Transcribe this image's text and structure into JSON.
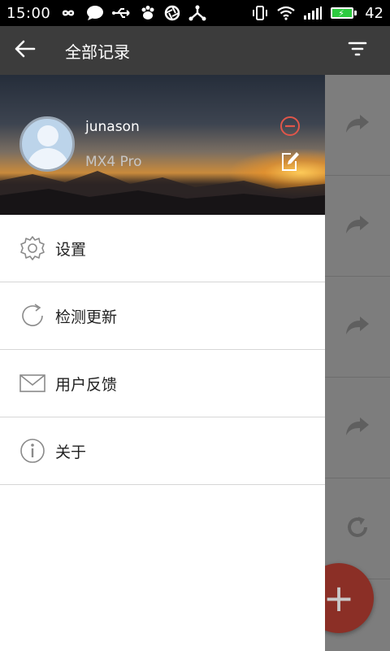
{
  "status_bar": {
    "time": "15:00",
    "battery_level": "42",
    "icons": [
      "infinity-icon",
      "chat-bubble-icon",
      "usb-icon",
      "paw-icon",
      "aperture-icon",
      "share-icon",
      "vibrate-icon",
      "wifi-icon",
      "signal-icon",
      "battery-charging-icon"
    ]
  },
  "app_bar": {
    "title": "全部记录",
    "back_icon": "back-arrow-icon",
    "filter_icon": "filter-icon"
  },
  "drawer": {
    "user": {
      "name": "junason",
      "device": "MX4 Pro"
    },
    "menu": [
      {
        "label": "设置",
        "icon": "gear-icon"
      },
      {
        "label": "检测更新",
        "icon": "refresh-icon"
      },
      {
        "label": "用户反馈",
        "icon": "mail-icon"
      },
      {
        "label": "关于",
        "icon": "info-icon"
      }
    ]
  },
  "fab": {
    "label": "+"
  },
  "colors": {
    "app_bar": "#3c3c3c",
    "logout_accent": "#e0564a",
    "fab": "#c0392b"
  }
}
